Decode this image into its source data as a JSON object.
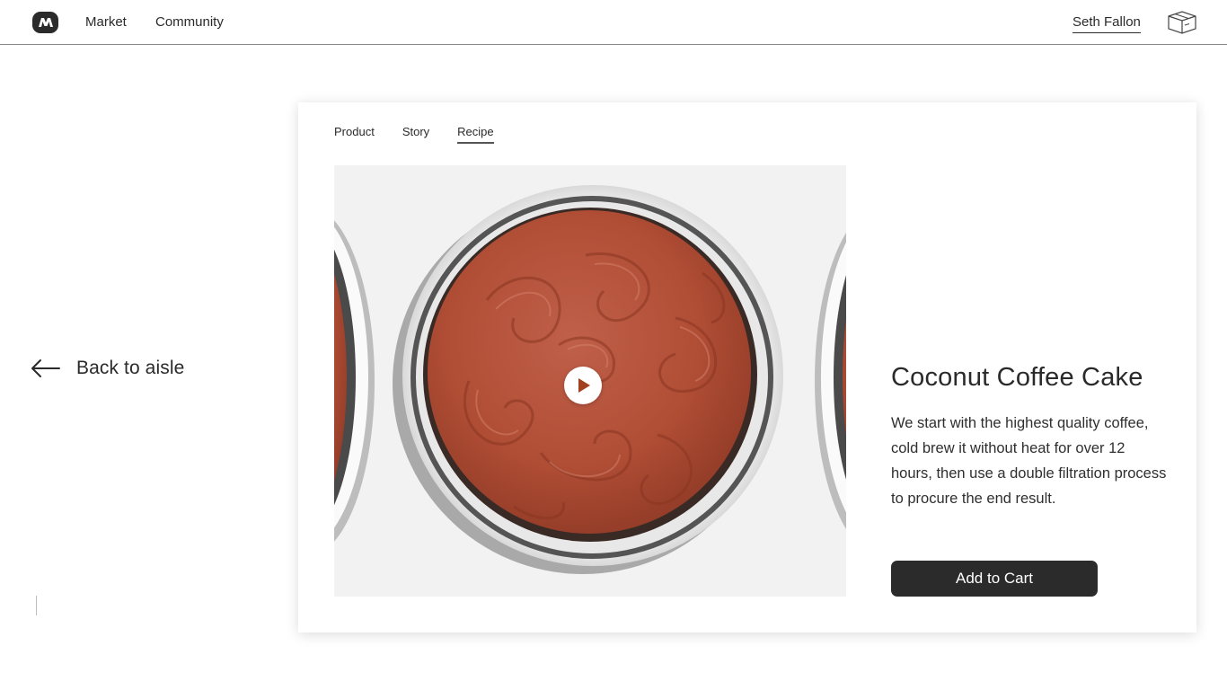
{
  "nav": {
    "logo_icon": "market-logo-icon",
    "links": [
      "Market",
      "Community"
    ],
    "user_name": "Seth Fallon",
    "cart_icon": "package-box-icon"
  },
  "back": {
    "label": "Back to aisle",
    "icon": "arrow-left-icon"
  },
  "product": {
    "tabs": [
      {
        "label": "Product",
        "active": false
      },
      {
        "label": "Story",
        "active": false
      },
      {
        "label": "Recipe",
        "active": true
      }
    ],
    "media": {
      "icon": "play-icon",
      "subject": "frosted chocolate cake on white plate"
    },
    "title": "Coconut Coffee Cake",
    "description": "We start with the highest quality coffee, cold brew it without heat for over 12 hours, then use a double filtration process to procure the end result.",
    "cta_label": "Add to Cart"
  },
  "colors": {
    "primary": "#2b2b2b",
    "media_bg": "#f2f2f2",
    "frosting": "#b5523a"
  }
}
